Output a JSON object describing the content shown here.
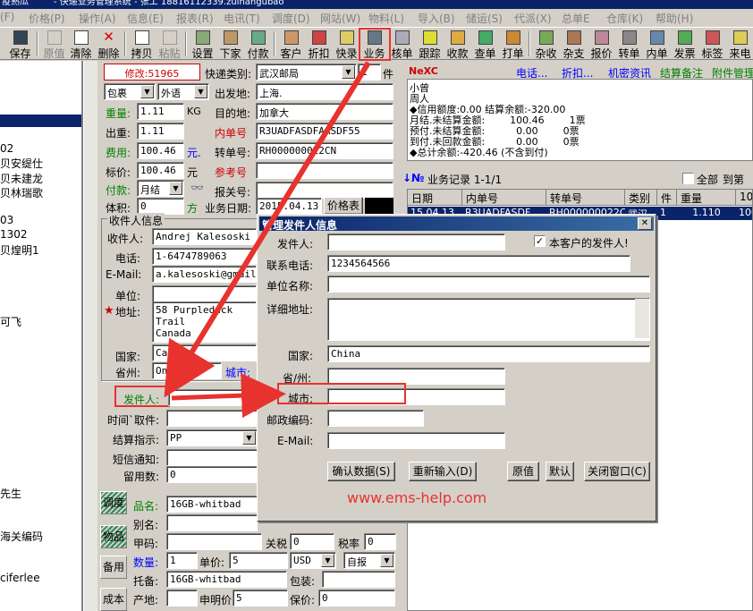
{
  "window": {
    "title": "快递国际业务管理系统 - 张工 18816112339 zuihangubao",
    "title_prefix": "疫熟瓜",
    "title_text": "- 快递业务管理系统 - 张工 18816112339.zuihangubao"
  },
  "menu": [
    "价格(P)",
    "操作(A)",
    "信息(E)",
    "报表(R)",
    "电讯(T)",
    "调度(D)",
    "网站(W)",
    "物料(L)",
    "导入(B)",
    "储运(S)",
    "代派(X)",
    "总单E",
    "仓库(K)",
    "帮助(H)"
  ],
  "menu_first": "(F)",
  "toolbar": [
    "保存",
    "原值",
    "清除",
    "删除",
    "拷贝",
    "粘贴",
    "设置",
    "下家",
    "付款",
    "客户",
    "折扣",
    "快录",
    "业务",
    "核单",
    "跟踪",
    "收款",
    "查单",
    "打单",
    "杂收",
    "杂支",
    "报价",
    "转单",
    "内单",
    "发票",
    "标签",
    "来电"
  ],
  "left_items": [
    "02",
    "贝安缇仕",
    "贝未建龙",
    "贝林瑞歌",
    "03",
    "1302",
    "贝煌明1",
    "可飞",
    "先生",
    "海关编码",
    "ciferlee"
  ],
  "form": {
    "modify_label": "修改:51965",
    "express_type_label": "快递类别:",
    "express_type_value": "武汉邮局",
    "piece_value": "1",
    "piece_label": "件",
    "package_value": "包裹",
    "language_value": "外语",
    "origin_label": "出发地:",
    "origin_value": "上海.",
    "weight_label": "重量:",
    "weight_value": "1.11",
    "weight_unit": "KG",
    "dest_label": "目的地:",
    "dest_value": "加拿大",
    "out_weight_label": "出重:",
    "out_weight_value": "1.11",
    "inner_no_label": "内单号",
    "inner_no_value": "R3UADFASDFAASDF55",
    "fee_label": "费用:",
    "fee_value": "100.46",
    "currency": "元.",
    "transfer_no_label": "转单号:",
    "transfer_no_value": "RH000000022CN",
    "price_label": "标价:",
    "price_value": "100.46",
    "price_unit": "元",
    "ref_no_label": "参考号",
    "pay_label": "付款:",
    "pay_value": "月结",
    "customs_no_label": "报关号:",
    "volume_label": "体积:",
    "volume_value": "0",
    "volume_unit": "方",
    "biz_date_label": "业务日期:",
    "biz_date_value": "2015.04.13",
    "price_table_button": "价格表"
  },
  "receiver": {
    "group_title": "收件人信息",
    "name_label": "收件人:",
    "name_value": "Andrej Kalesoski",
    "phone_label": "电话:",
    "phone_value": "1-6474789063",
    "email_label": "E-Mail:",
    "email_value": "a.kalesoski@gmail.c",
    "company_label": "单位:",
    "address_label": "地址:",
    "address_value_1": "58 Purpleduck Trail",
    "address_value_2": "Canada",
    "country_label": "国家:",
    "country_value": "Canada",
    "province_label": "省州:",
    "province_value": "Ontario",
    "city_label": "城市:"
  },
  "sender": {
    "sender_label": "发件人:",
    "time_label": "时间`取件:",
    "settle_label": "结算指示:",
    "settle_value": "PP",
    "sms_label": "短信通知:",
    "message_label": "留用数:",
    "message_value": "0"
  },
  "goods": {
    "tabs": [
      "调度",
      "物品",
      "备用",
      "成本"
    ],
    "name_label": "品名:",
    "name_value": "16GB-whitbad",
    "alias_label": "别名:",
    "code_label": "甲码:",
    "tariff_label": "关税",
    "tariff_value": "0",
    "tax_label": "税率",
    "tax_value": "0",
    "qty_label": "数量:",
    "qty_value": "1",
    "unit_price_label": "单价:",
    "unit_price_value": "5",
    "currency_value": "USD",
    "self_value": "自报",
    "consign_label": "托备:",
    "consign_value": "16GB-whitbad",
    "pack_label": "包装:",
    "origin_label": "产地:",
    "declared_label": "申明价",
    "declared_value": "5",
    "insured_label": "保价:",
    "insured_value": "0"
  },
  "right": {
    "logo": "NeXC",
    "links": [
      "电话...",
      "折扣...",
      "机密资讯",
      "结算备注",
      "附件管理"
    ],
    "info_lines": [
      "小曾",
      "周人",
      "◆信用额度:0.00 结算余额:-320.00",
      "月结.未结算金额:        100.46        1票",
      "预付.未结算金额:          0.00        0票",
      "到付.未回款金额:          0.00        0票",
      "◆总计余额:-420.46 (不含到付)"
    ],
    "records_label": "业务记录 1-1/1",
    "all_label": "全部",
    "to_label": "到第",
    "grid_headers": [
      "日期",
      "内单号",
      "转单号",
      "类别",
      "件",
      "重量",
      "10"
    ],
    "grid_row": [
      "15.04.13",
      "R3UADFASDF",
      "RH000000022CN",
      "武汉",
      "1",
      "1.110",
      "100"
    ]
  },
  "dialog": {
    "title": "管理发件人信息",
    "sender_label": "发件人:",
    "sender_value": "",
    "own_customer_label": "本客户的发件人!",
    "own_customer_checked": true,
    "phone_label": "联系电话:",
    "phone_value": "1234564566",
    "company_label": "单位名称:",
    "address_label": "详细地址:",
    "country_label": "国家:",
    "country_value": "China",
    "province_label": "省/州:",
    "city_label": "城市:",
    "zip_label": "邮政编码:",
    "email_label": "E-Mail:",
    "buttons": [
      "确认数据(S)",
      "重新输入(D)",
      "原值",
      "默认",
      "关闭窗口(C)"
    ]
  },
  "watermark": "www.ems-help.com",
  "accent_red": "#e8322d"
}
